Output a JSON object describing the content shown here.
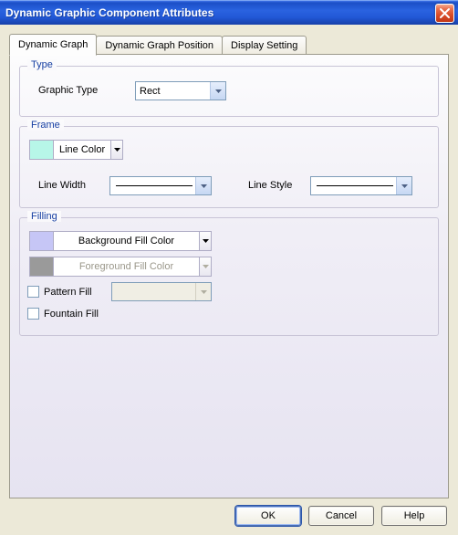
{
  "window": {
    "title": "Dynamic Graphic Component Attributes"
  },
  "tabs": {
    "t0": "Dynamic Graph",
    "t1": "Dynamic Graph Position",
    "t2": "Display Setting"
  },
  "type_group": {
    "legend": "Type",
    "graphic_type_label": "Graphic Type",
    "graphic_type_value": "Rect"
  },
  "frame_group": {
    "legend": "Frame",
    "line_color_label": "Line Color",
    "line_color_swatch": "#b7f6e8",
    "line_width_label": "Line Width",
    "line_style_label": "Line Style"
  },
  "filling_group": {
    "legend": "Filling",
    "bg_swatch": "#c6c6f6",
    "bg_label": "Background Fill Color",
    "fg_swatch": "#9a9a9a",
    "fg_label": "Foreground Fill Color",
    "pattern_label": "Pattern Fill",
    "fountain_label": "Fountain Fill"
  },
  "buttons": {
    "ok": "OK",
    "cancel": "Cancel",
    "help": "Help"
  }
}
